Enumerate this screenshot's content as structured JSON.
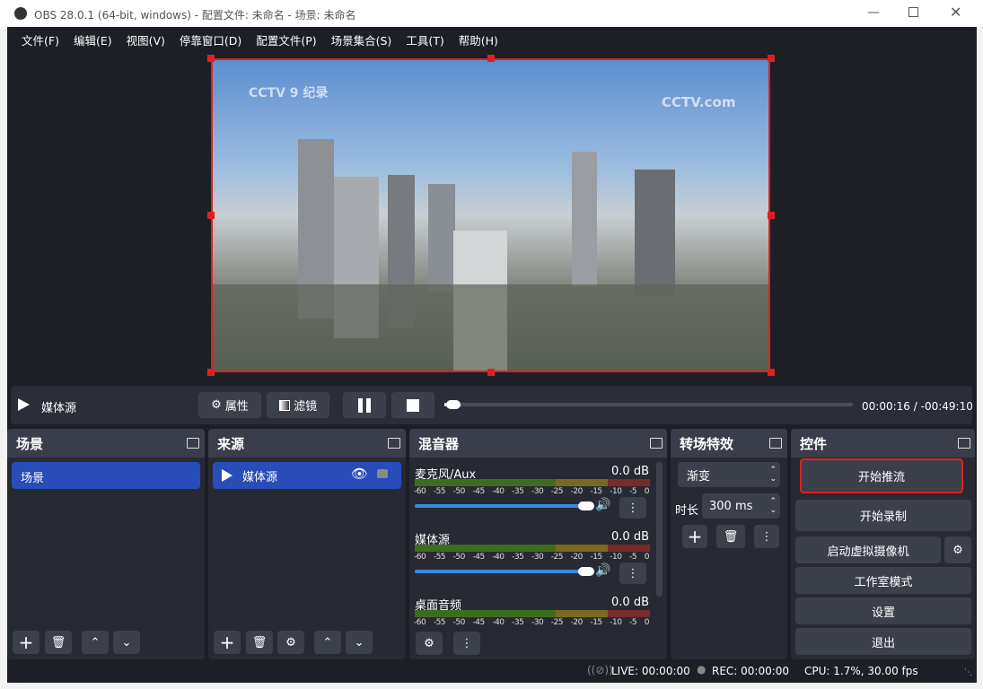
{
  "window": {
    "title": "OBS 28.0.1 (64-bit, windows) - 配置文件: 未命名 - 场景: 未命名"
  },
  "menu": [
    "文件(F)",
    "编辑(E)",
    "视图(V)",
    "停靠窗口(D)",
    "配置文件(P)",
    "场景集合(S)",
    "工具(T)",
    "帮助(H)"
  ],
  "preview": {
    "watermark_left": "CCTV 9 纪录",
    "watermark_right": "CCTV.com"
  },
  "media_bar": {
    "source_name": "媒体源",
    "properties": "属性",
    "filters": "滤镜",
    "time": "00:00:16",
    "separator": "/",
    "remaining": "-00:49:10",
    "progress": 0.005
  },
  "scenes": {
    "title": "场景",
    "items": [
      "场景"
    ]
  },
  "sources": {
    "title": "来源",
    "items": [
      "媒体源"
    ]
  },
  "mixer": {
    "title": "混音器",
    "ticks": [
      "-60",
      "-55",
      "-50",
      "-45",
      "-40",
      "-35",
      "-30",
      "-25",
      "-20",
      "-15",
      "-10",
      "-5",
      "0"
    ],
    "channels": [
      {
        "name": "麦克风/Aux",
        "db": "0.0 dB",
        "volume": 1.0
      },
      {
        "name": "媒体源",
        "db": "0.0 dB",
        "volume": 1.0
      },
      {
        "name": "桌面音频",
        "db": "0.0 dB",
        "volume": 1.0
      }
    ]
  },
  "transitions": {
    "title": "转场特效",
    "selected": "渐变",
    "duration_label": "时长",
    "duration": "300 ms"
  },
  "controls": {
    "title": "控件",
    "start_stream": "开始推流",
    "start_record": "开始录制",
    "virtual_cam": "启动虚拟摄像机",
    "studio_mode": "工作室模式",
    "settings": "设置",
    "exit": "退出"
  },
  "status": {
    "live": "LIVE: 00:00:00",
    "rec": "REC: 00:00:00",
    "cpu": "CPU: 1.7%, 30.00 fps"
  },
  "colors": {
    "selection": "#284cb8",
    "highlight": "#e02020",
    "meter_green": "#3f6b1f",
    "slider": "#3a8ae0"
  }
}
